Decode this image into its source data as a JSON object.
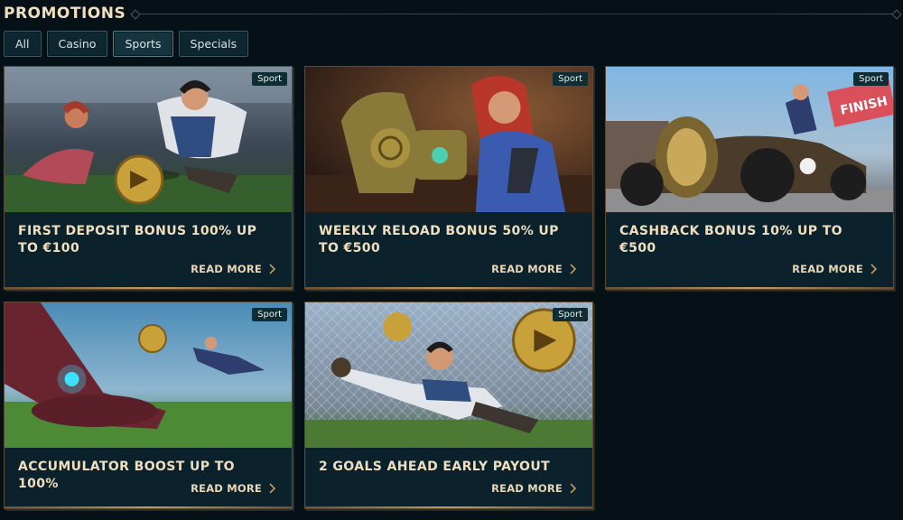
{
  "header": {
    "title": "PROMOTIONS"
  },
  "tabs": [
    {
      "label": "All",
      "active": false
    },
    {
      "label": "Casino",
      "active": false
    },
    {
      "label": "Sports",
      "active": true
    },
    {
      "label": "Specials",
      "active": false
    }
  ],
  "cards": [
    {
      "badge": "Sport",
      "title": "First Deposit Bonus 100% up to €100",
      "cta": "READ MORE"
    },
    {
      "badge": "Sport",
      "title": "Weekly Reload Bonus 50% up to €500",
      "cta": "READ MORE"
    },
    {
      "badge": "Sport",
      "title": "Cashback Bonus 10% up to €500",
      "cta": "READ MORE"
    },
    {
      "badge": "Sport",
      "title": "Accumulator Boost up to 100%",
      "cta": "READ MORE"
    },
    {
      "badge": "Sport",
      "title": "2 Goals Ahead Early Payout",
      "cta": "READ MORE"
    }
  ],
  "colors": {
    "background": "#061117",
    "card": "#0b222c",
    "title_text": "#f0dfbf",
    "accent_gold": "#c79a5a",
    "badge_bg": "#0f2d33"
  },
  "icons": [
    "chevron-right-icon"
  ]
}
